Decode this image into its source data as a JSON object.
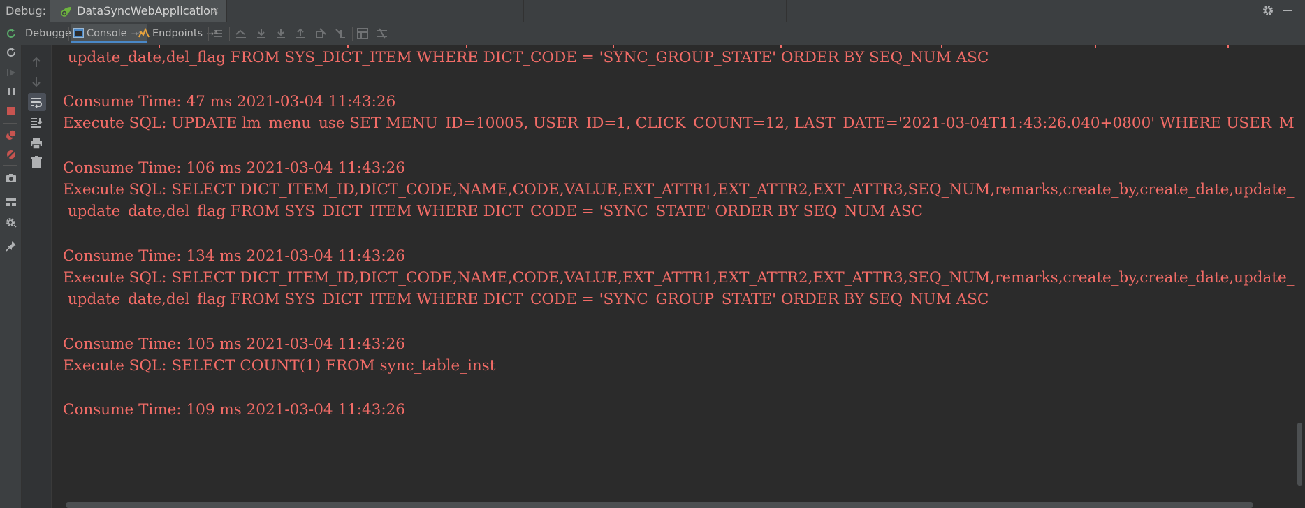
{
  "titlebar": {
    "debug_label": "Debug:",
    "run_tab_label": "DataSyncWebApplication",
    "close_glyph": "×",
    "icons": [
      "spring-boot-icon",
      "settings-gear-icon",
      "minimize-icon"
    ]
  },
  "toolbar": {
    "tabs": [
      {
        "label": "Debugger",
        "active": false
      },
      {
        "label": "Console",
        "active": true,
        "pin": "→*"
      },
      {
        "label": "Endpoints",
        "active": false,
        "pin": "→*"
      }
    ],
    "icons": [
      "show-execution-point-icon",
      "step-over-icon",
      "step-into-icon",
      "force-step-into-icon",
      "step-out-icon",
      "drop-frame-icon",
      "run-to-cursor-icon",
      "evaluate-expression-icon",
      "trace-icon"
    ]
  },
  "left_strip": {
    "icons": [
      "rerun-icon",
      "restore-icon",
      "resume-icon",
      "pause-icon",
      "stop-icon",
      "view-breakpoints-icon",
      "mute-breakpoints-icon",
      "camera-icon",
      "layout-icon",
      "settings-icon",
      "pin-icon"
    ]
  },
  "console_strip": {
    "icons": [
      "scroll-up-icon",
      "scroll-down-icon",
      "soft-wrap-icon",
      "scroll-to-end-icon",
      "print-icon",
      "clear-all-icon"
    ]
  },
  "console": {
    "text_color": "#f26c67",
    "lines": [
      " update_date,del_flag FROM SYS_DICT_ITEM WHERE DICT_CODE = 'SYNC_GROUP_STATE' ORDER BY SEQ_NUM ASC",
      "Consume Time: 47 ms 2021-03-04 11:43:26",
      "Execute SQL: UPDATE lm_menu_use SET MENU_ID=10005, USER_ID=1, CLICK_COUNT=12, LAST_DATE='2021-03-04T11:43:26.040+0800' WHERE USER_MENU_",
      "Consume Time: 106 ms 2021-03-04 11:43:26",
      "Execute SQL: SELECT DICT_ITEM_ID,DICT_CODE,NAME,CODE,VALUE,EXT_ATTR1,EXT_ATTR2,EXT_ATTR3,SEQ_NUM,remarks,create_by,create_date,update_by,",
      " update_date,del_flag FROM SYS_DICT_ITEM WHERE DICT_CODE = 'SYNC_STATE' ORDER BY SEQ_NUM ASC",
      "Consume Time: 134 ms 2021-03-04 11:43:26",
      "Execute SQL: SELECT DICT_ITEM_ID,DICT_CODE,NAME,CODE,VALUE,EXT_ATTR1,EXT_ATTR2,EXT_ATTR3,SEQ_NUM,remarks,create_by,create_date,update_by,",
      " update_date,del_flag FROM SYS_DICT_ITEM WHERE DICT_CODE = 'SYNC_GROUP_STATE' ORDER BY SEQ_NUM ASC",
      "Consume Time: 105 ms 2021-03-04 11:43:26",
      "Execute SQL: SELECT COUNT(1) FROM sync_table_inst",
      "Consume Time: 109 ms 2021-03-04 11:43:26"
    ]
  }
}
